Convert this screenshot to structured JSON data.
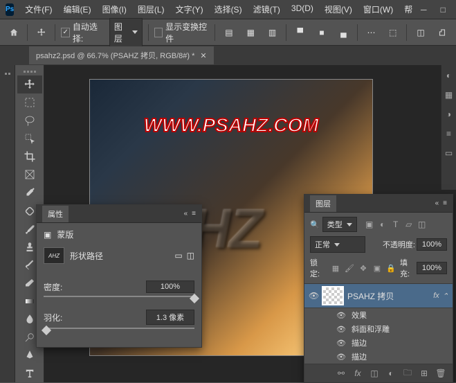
{
  "menu": {
    "file": "文件(F)",
    "edit": "编辑(E)",
    "image": "图像(I)",
    "layer": "图层(L)",
    "type": "文字(Y)",
    "select": "选择(S)",
    "filter": "滤镜(T)",
    "threeD": "3D(D)",
    "view": "视图(V)",
    "window": "窗口(W)",
    "help": "帮"
  },
  "options": {
    "autoSelect": "自动选择:",
    "target": "图层",
    "showTransform": "显示变换控件"
  },
  "document": {
    "title": "psahz2.psd @ 66.7% (PSAHZ 拷贝, RGB/8#) *"
  },
  "canvas": {
    "watermark": "WWW.PSAHZ.COM",
    "text": "AHZ"
  },
  "properties": {
    "title": "属性",
    "maskLabel": "蒙版",
    "pathLabel": "形状路径",
    "density": "密度:",
    "densityValue": "100%",
    "feather": "羽化:",
    "featherValue": "1.3 像素"
  },
  "layers": {
    "title": "图层",
    "kind": "类型",
    "blendMode": "正常",
    "opacityLabel": "不透明度:",
    "opacityValue": "100%",
    "lockLabel": "锁定:",
    "fillLabel": "填充:",
    "fillValue": "100%",
    "layer1": "PSAHZ 拷贝",
    "fxBadge": "fx",
    "effectsLabel": "效果",
    "effect1": "斜面和浮雕",
    "effect2": "描边",
    "effect3": "描边"
  }
}
